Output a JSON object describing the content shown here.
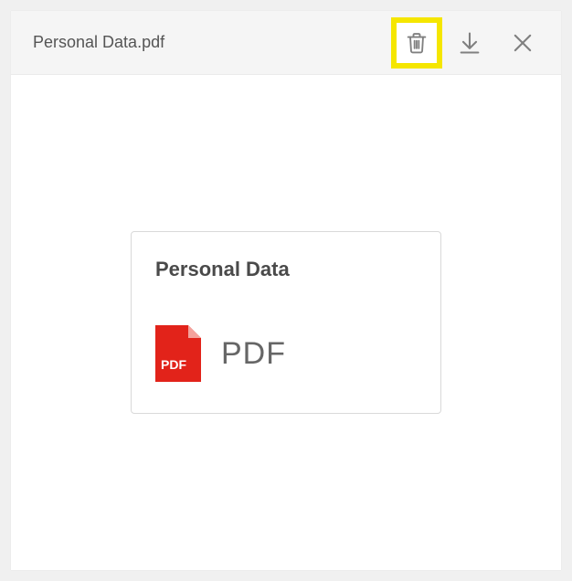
{
  "header": {
    "title": "Personal Data.pdf"
  },
  "preview": {
    "title": "Personal Data",
    "file_type_label": "PDF",
    "icon_badge_text": "PDF"
  },
  "colors": {
    "highlight": "#f5e600",
    "pdf_red": "#e2231a"
  }
}
